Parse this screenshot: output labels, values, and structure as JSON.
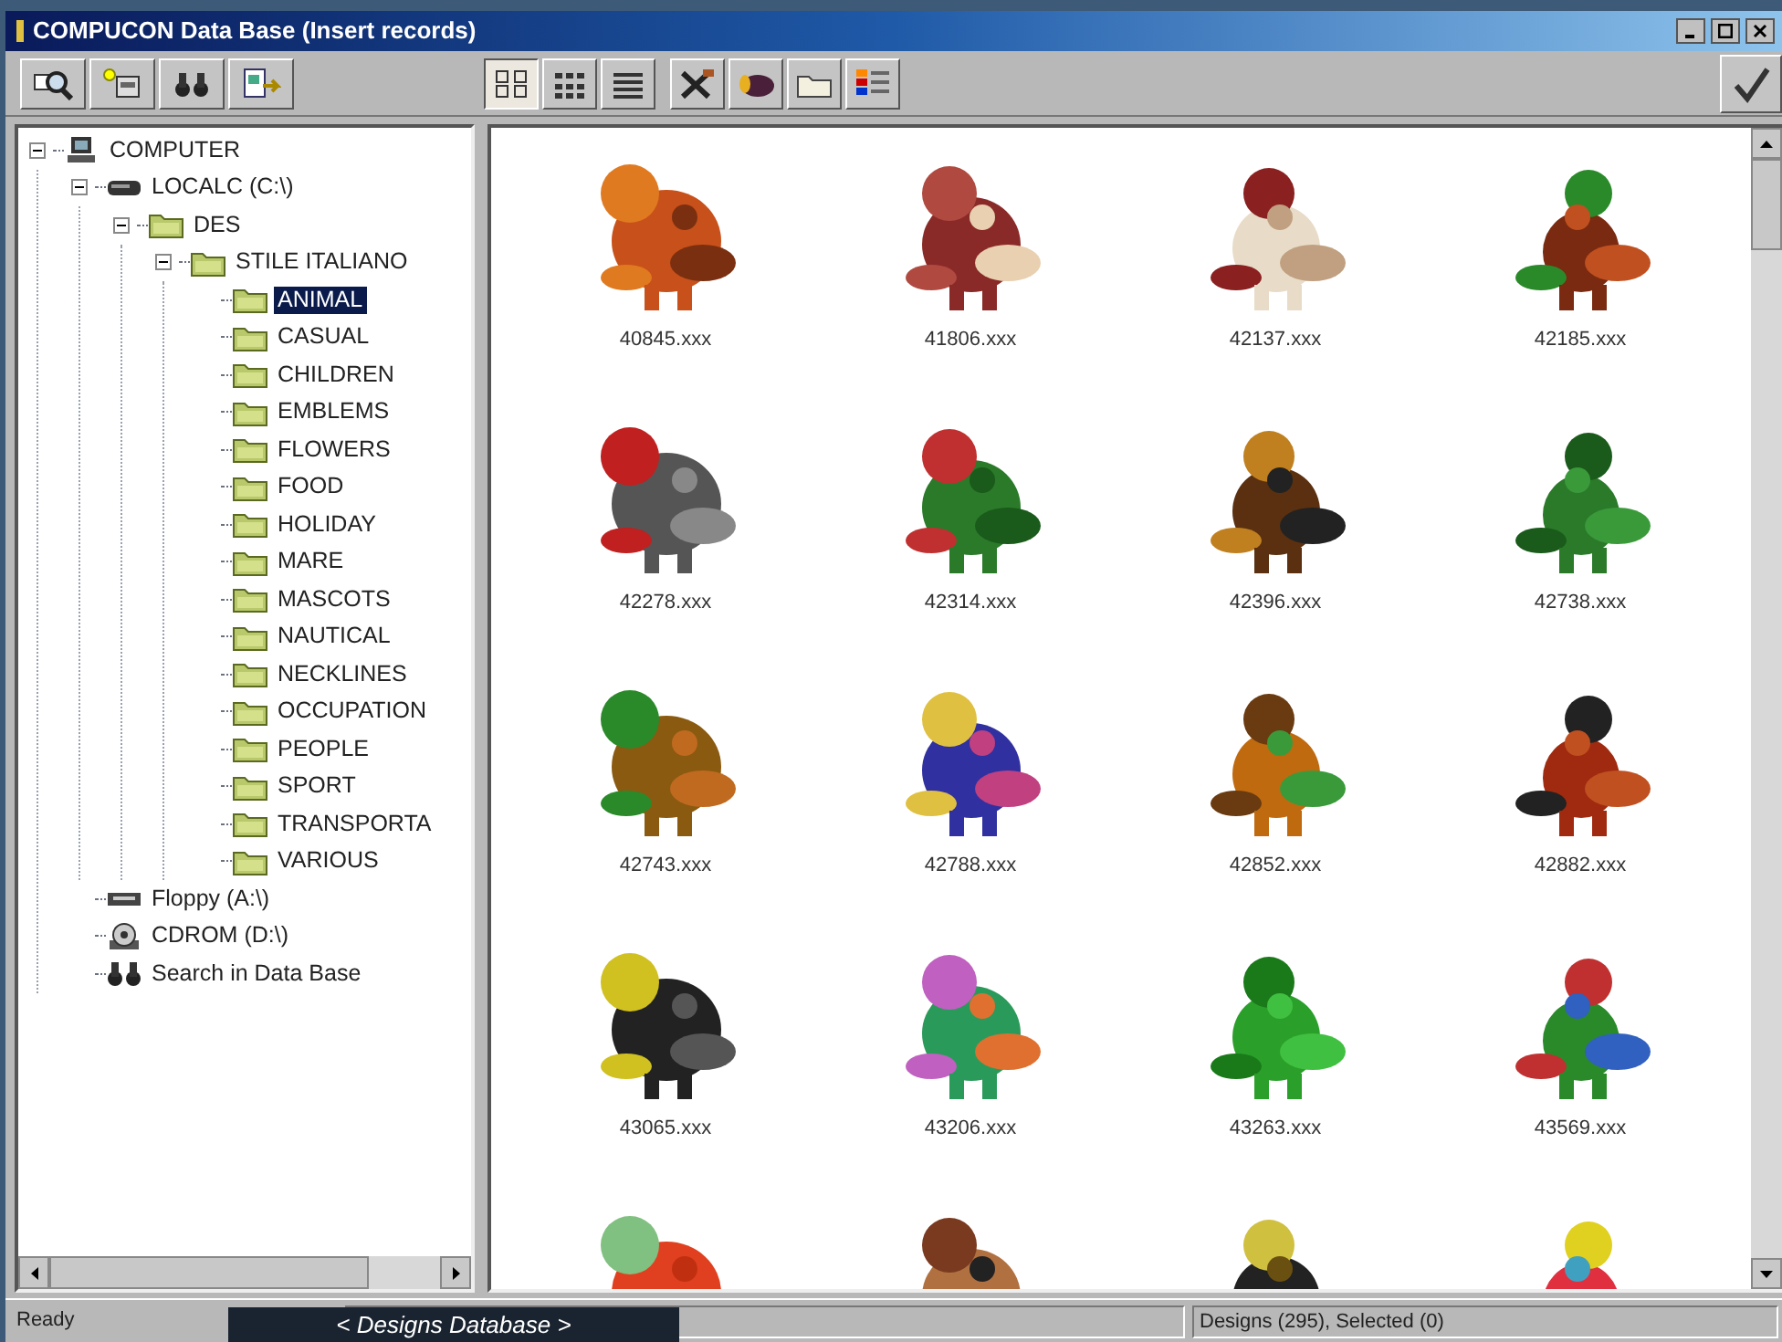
{
  "window": {
    "title": "COMPUCON Data Base (Insert records)"
  },
  "toolbar": {
    "left": [
      {
        "kind": "zoom"
      },
      {
        "kind": "new-record"
      },
      {
        "kind": "search"
      },
      {
        "kind": "export"
      }
    ],
    "right": [
      {
        "kind": "large-icons",
        "selected": true
      },
      {
        "kind": "small-icons",
        "selected": false
      },
      {
        "kind": "list",
        "selected": false
      },
      {
        "kind": "tools",
        "selected": false
      },
      {
        "kind": "thread",
        "selected": false
      },
      {
        "kind": "folder",
        "selected": false
      },
      {
        "kind": "palette",
        "selected": false
      }
    ],
    "confirm": {
      "kind": "check"
    }
  },
  "tree": [
    {
      "label": "COMPUTER",
      "kind": "computer",
      "selected": false,
      "expanded": true,
      "children": [
        {
          "label": "LOCALC (C:\\)",
          "kind": "drive",
          "selected": false,
          "expanded": true,
          "children": [
            {
              "label": "DES",
              "kind": "folder",
              "selected": false,
              "expanded": true,
              "children": [
                {
                  "label": "STILE ITALIANO",
                  "kind": "folder",
                  "selected": false,
                  "expanded": true,
                  "children": [
                    {
                      "label": "ANIMAL",
                      "kind": "folder",
                      "selected": true
                    },
                    {
                      "label": "CASUAL",
                      "kind": "folder",
                      "selected": false
                    },
                    {
                      "label": "CHILDREN",
                      "kind": "folder",
                      "selected": false
                    },
                    {
                      "label": "EMBLEMS",
                      "kind": "folder",
                      "selected": false
                    },
                    {
                      "label": "FLOWERS",
                      "kind": "folder",
                      "selected": false
                    },
                    {
                      "label": "FOOD",
                      "kind": "folder",
                      "selected": false
                    },
                    {
                      "label": "HOLIDAY",
                      "kind": "folder",
                      "selected": false
                    },
                    {
                      "label": "MARE",
                      "kind": "folder",
                      "selected": false
                    },
                    {
                      "label": "MASCOTS",
                      "kind": "folder",
                      "selected": false
                    },
                    {
                      "label": "NAUTICAL",
                      "kind": "folder",
                      "selected": false
                    },
                    {
                      "label": "NECKLINES",
                      "kind": "folder",
                      "selected": false
                    },
                    {
                      "label": "OCCUPATION",
                      "kind": "folder",
                      "selected": false
                    },
                    {
                      "label": "PEOPLE",
                      "kind": "folder",
                      "selected": false
                    },
                    {
                      "label": "SPORT",
                      "kind": "folder",
                      "selected": false
                    },
                    {
                      "label": "TRANSPORTA",
                      "kind": "folder",
                      "selected": false
                    },
                    {
                      "label": "VARIOUS",
                      "kind": "folder",
                      "selected": false
                    }
                  ]
                }
              ]
            }
          ]
        },
        {
          "label": "Floppy (A:\\)",
          "kind": "floppy",
          "selected": false
        },
        {
          "label": "CDROM (D:\\)",
          "kind": "cdrom",
          "selected": false
        },
        {
          "label": "Search in Data Base",
          "kind": "search",
          "selected": false
        }
      ]
    }
  ],
  "designs": [
    {
      "kind": "picture",
      "label": "40845.xxx"
    },
    {
      "kind": "picture",
      "label": "41806.xxx"
    },
    {
      "kind": "picture",
      "label": "42137.xxx"
    },
    {
      "kind": "picture",
      "label": "42185.xxx"
    },
    {
      "kind": "picture",
      "label": "42278.xxx"
    },
    {
      "kind": "picture",
      "label": "42314.xxx"
    },
    {
      "kind": "picture",
      "label": "42396.xxx"
    },
    {
      "kind": "picture",
      "label": "42738.xxx"
    },
    {
      "kind": "picture",
      "label": "42743.xxx"
    },
    {
      "kind": "picture",
      "label": "42788.xxx"
    },
    {
      "kind": "picture",
      "label": "42852.xxx"
    },
    {
      "kind": "picture",
      "label": "42882.xxx"
    },
    {
      "kind": "picture",
      "label": "43065.xxx"
    },
    {
      "kind": "picture",
      "label": "43206.xxx"
    },
    {
      "kind": "picture",
      "label": "43263.xxx"
    },
    {
      "kind": "picture",
      "label": "43569.xxx"
    },
    {
      "kind": "picture"
    },
    {
      "kind": "picture"
    },
    {
      "kind": "picture"
    },
    {
      "kind": "picture"
    }
  ],
  "status_bar": {
    "message": "Ready",
    "counts": "Designs (295), Selected (0)"
  },
  "caption": "< Designs Database >"
}
